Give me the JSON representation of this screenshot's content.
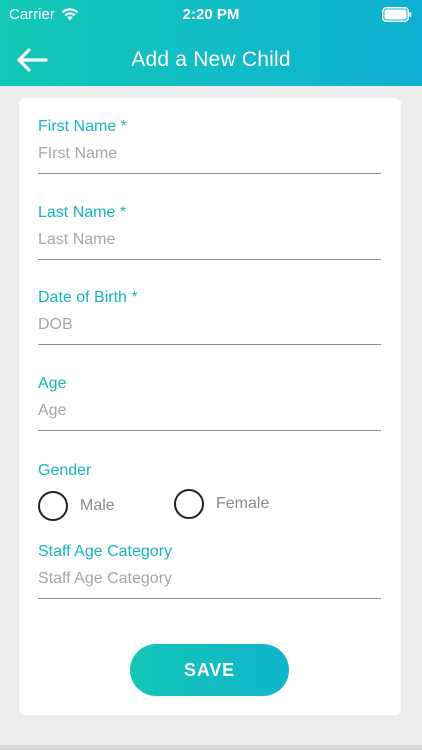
{
  "status_bar": {
    "carrier": "Carrier",
    "time": "2:20 PM",
    "wifi_icon": "wifi-icon",
    "battery_icon": "battery-icon"
  },
  "nav": {
    "back_icon": "arrow-left-icon",
    "title": "Add a New Child"
  },
  "form": {
    "first_name": {
      "label": "First Name *",
      "placeholder": "FIrst Name",
      "value": ""
    },
    "last_name": {
      "label": "Last Name *",
      "placeholder": "Last Name",
      "value": ""
    },
    "dob": {
      "label": "Date of Birth *",
      "placeholder": "DOB",
      "value": ""
    },
    "age": {
      "label": "Age",
      "placeholder": "Age",
      "value": ""
    },
    "gender": {
      "label": "Gender",
      "options": [
        {
          "label": "Male",
          "selected": false
        },
        {
          "label": "Female",
          "selected": false
        }
      ]
    },
    "staff_age_category": {
      "label": "Staff Age Category",
      "placeholder": "Staff Age Category",
      "value": ""
    }
  },
  "actions": {
    "save_label": "SAVE"
  },
  "colors": {
    "accent": "#12b6c2",
    "header_gradient_start": "#13c8b5",
    "header_gradient_end": "#0fb0d2",
    "background": "#ececec"
  }
}
